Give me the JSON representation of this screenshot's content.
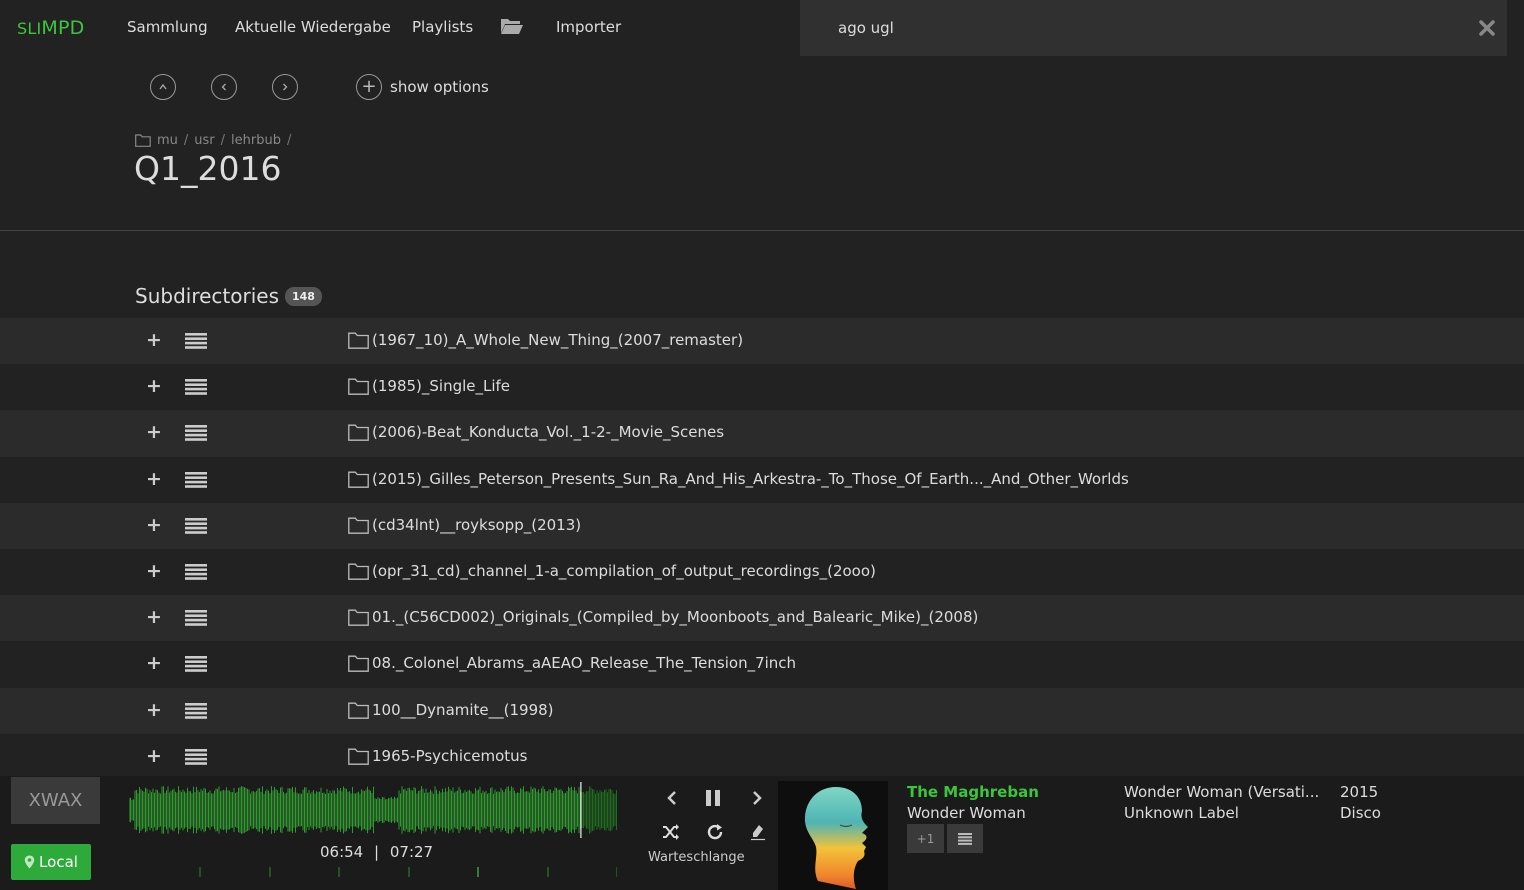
{
  "app": {
    "brand_a": "SLI",
    "brand_b": "MPD"
  },
  "nav": [
    {
      "label": "Sammlung"
    },
    {
      "label": "Aktuelle Wiedergabe"
    },
    {
      "label": "Playlists"
    },
    {
      "label": "Importer"
    }
  ],
  "search": {
    "value": "ago ugl",
    "placeholder": ""
  },
  "toolbar": {
    "show_options_label": "show options"
  },
  "breadcrumb": [
    "mu",
    "usr",
    "lehrbub"
  ],
  "page_title": "Q1_2016",
  "subdirectories": {
    "label": "Subdirectories",
    "count": "148",
    "items": [
      {
        "name": "(1967_10)_A_Whole_New_Thing_(2007_remaster)"
      },
      {
        "name": "(1985)_Single_Life"
      },
      {
        "name": "(2006)-Beat_Konducta_Vol._1-2-_Movie_Scenes"
      },
      {
        "name": "(2015)_Gilles_Peterson_Presents_Sun_Ra_And_His_Arkestra-_To_Those_Of_Earth..._And_Other_Worlds"
      },
      {
        "name": "(cd34lnt)__royksopp_(2013)"
      },
      {
        "name": "(opr_31_cd)_channel_1-a_compilation_of_output_recordings_(2ooo)"
      },
      {
        "name": "01._(C56CD002)_Originals_(Compiled_by_Moonboots_and_Balearic_Mike)_(2008)"
      },
      {
        "name": "08._Colonel_Abrams_aAEAO_Release_The_Tension_7inch"
      },
      {
        "name": "100__Dynamite__(1998)"
      },
      {
        "name": "1965-Psychicemotus"
      }
    ]
  },
  "player": {
    "deck_label": "XWAX",
    "local_label": "Local",
    "elapsed": "06:54",
    "separator": "|",
    "total": "07:27",
    "progress": 0.926,
    "queue_label": "Warteschlange",
    "artist": "The Maghreban",
    "title": "Wonder Woman",
    "plus_one": "+1",
    "album": "Wonder Woman (Versati...",
    "label": "Unknown Label",
    "year": "2015",
    "genre": "Disco",
    "accent": "#3cc63c"
  }
}
